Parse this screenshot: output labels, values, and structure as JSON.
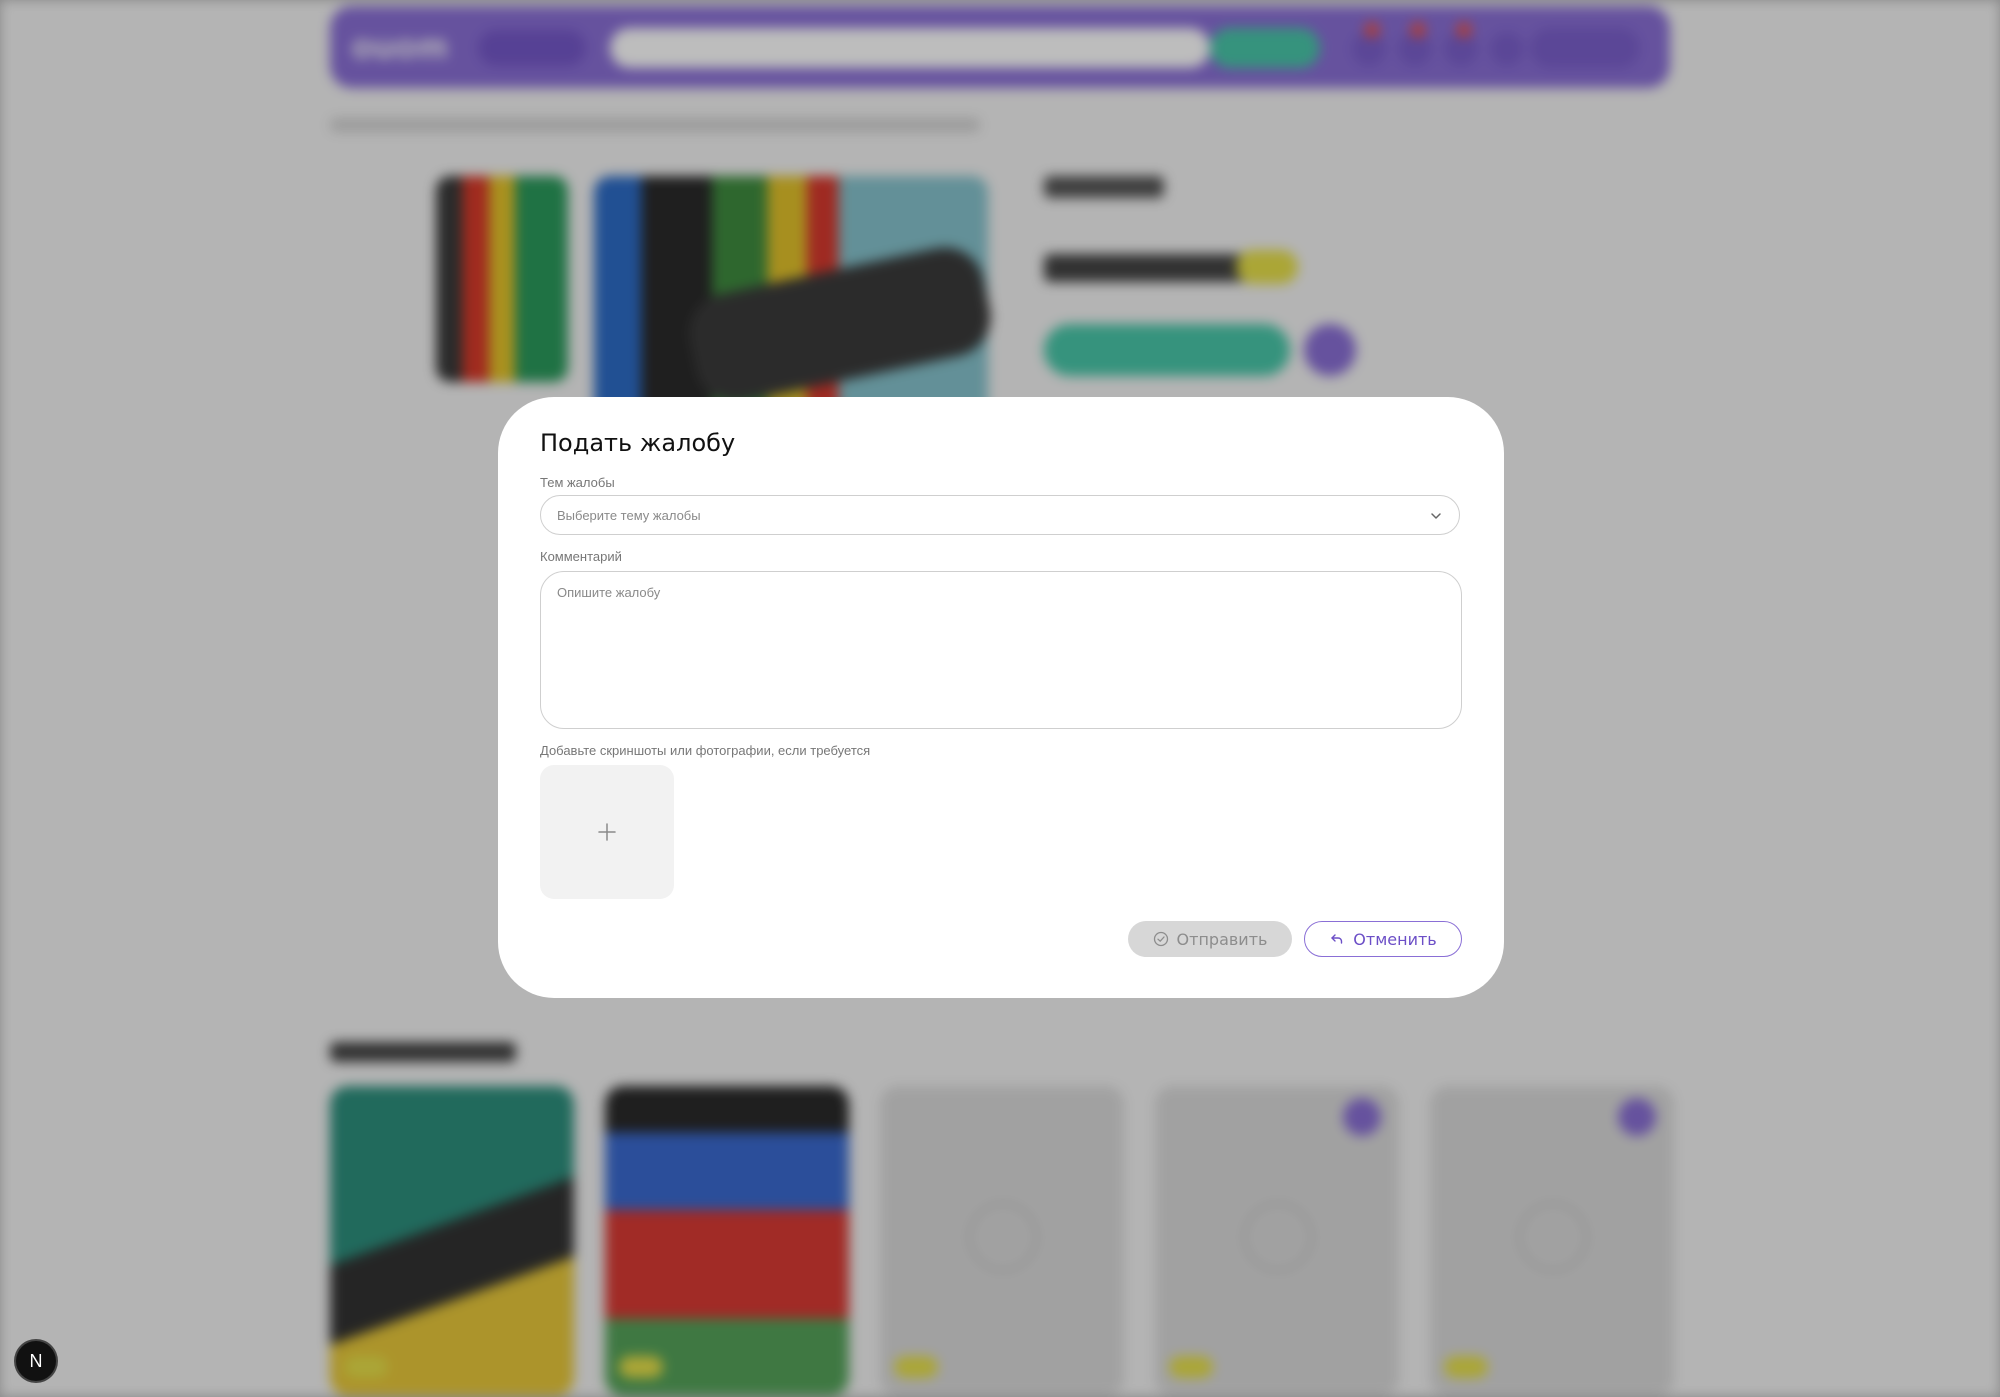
{
  "modal": {
    "title": "Подать жалобу",
    "topic_label": "Тем жалобы",
    "topic_placeholder": "Выберите тему жалобы",
    "comment_label": "Комментарий",
    "comment_placeholder": "Опишите жалобу",
    "upload_label": "Добавьте скриншоты или фотографии, если требуется",
    "submit_label": "Отправить",
    "cancel_label": "Отменить",
    "submit_enabled": false
  },
  "framework_badge": {
    "letter": "N"
  },
  "colors": {
    "accent": "#8a6fd6",
    "cta": "#49c7a9",
    "discount": "#e7e04a"
  },
  "icons": {
    "topic_select": "chevron-down-icon",
    "upload": "plus-icon",
    "submit": "check-circle-icon",
    "cancel": "undo-arrow-icon"
  }
}
